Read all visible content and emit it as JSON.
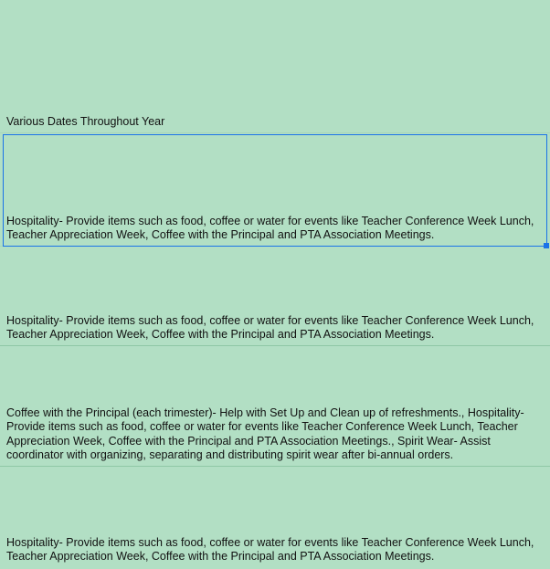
{
  "rows": [
    {
      "text": "Various Dates Throughout Year"
    },
    {
      "text": "Hospitality- Provide items such as food, coffee or water for events like Teacher Conference Week Lunch, Teacher Appreciation Week, Coffee with the Principal and PTA Association Meetings."
    },
    {
      "text": "Hospitality- Provide items such as food, coffee or water for events like Teacher Conference Week Lunch, Teacher Appreciation Week, Coffee with the Principal and PTA Association Meetings."
    },
    {
      "text": "Coffee with the Principal (each trimester)- Help with Set Up and Clean up of refreshments., Hospitality- Provide items such as food, coffee or water for events like Teacher Conference Week Lunch, Teacher Appreciation Week, Coffee with the Principal and PTA Association Meetings., Spirit Wear- Assist coordinator with organizing, separating and distributing spirit wear after bi-annual orders."
    },
    {
      "text": "Hospitality- Provide items such as food, coffee or water for events like Teacher Conference Week Lunch, Teacher Appreciation Week, Coffee with the Principal and PTA Association Meetings."
    }
  ]
}
